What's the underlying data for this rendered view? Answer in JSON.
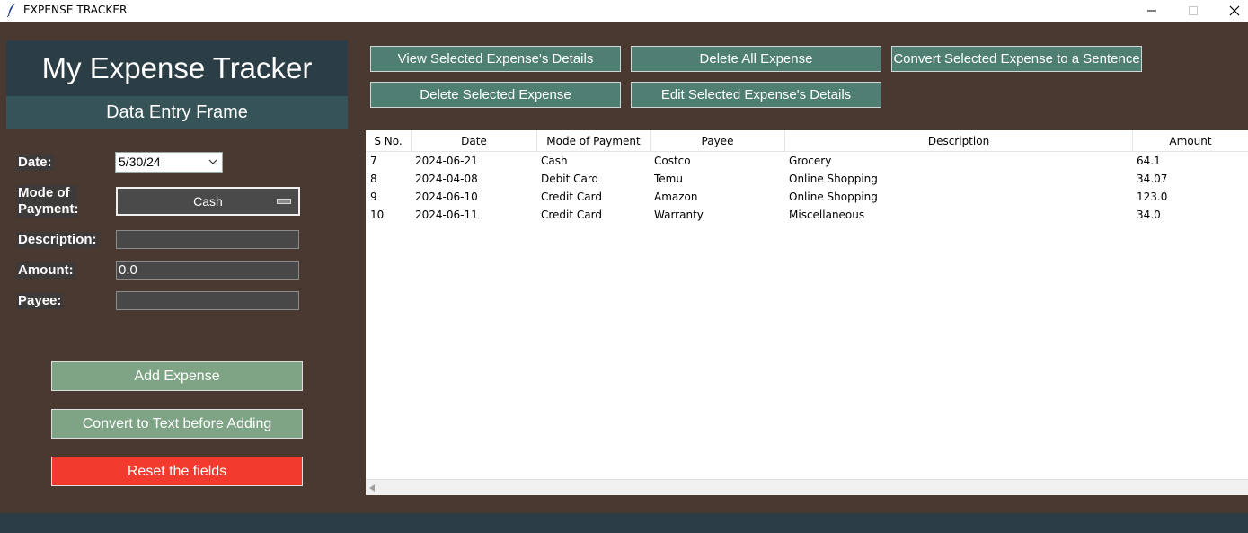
{
  "window": {
    "title": "EXPENSE TRACKER"
  },
  "left": {
    "heading": "My Expense Tracker",
    "subheading": "Data Entry Frame",
    "labels": {
      "date": "Date:",
      "mode": "Mode of Payment:",
      "description": "Description:",
      "amount": "Amount:",
      "payee": "Payee:"
    },
    "fields": {
      "date": "5/30/24",
      "mode": "Cash",
      "description": "",
      "amount": "0.0",
      "payee": ""
    },
    "buttons": {
      "add": "Add Expense",
      "convert": "Convert to Text before Adding",
      "reset": "Reset the fields"
    }
  },
  "toolbar": {
    "view": "View Selected Expense's Details",
    "delete_all": "Delete All Expense",
    "sentence": "Convert Selected Expense to a Sentence",
    "delete_selected": "Delete Selected Expense",
    "edit": "Edit Selected Expense's Details"
  },
  "table": {
    "columns": [
      "S No.",
      "Date",
      "Mode of Payment",
      "Payee",
      "Description",
      "Amount"
    ],
    "rows": [
      [
        "7",
        "2024-06-21",
        "Cash",
        "Costco",
        "Grocery",
        "64.1"
      ],
      [
        "8",
        "2024-04-08",
        "Debit Card",
        "Temu",
        "Online Shopping",
        "34.07"
      ],
      [
        "9",
        "2024-06-10",
        "Credit Card",
        "Amazon",
        "Online Shopping",
        "123.0"
      ],
      [
        "10",
        "2024-06-11",
        "Credit Card",
        "Warranty",
        "Miscellaneous",
        "34.0"
      ]
    ]
  },
  "colors": {
    "background": "#493930",
    "heading": "#2c3e45",
    "subheading": "#365358",
    "toolbar_button": "#4f7e72",
    "add_button": "#7ea385",
    "reset_button": "#f23b2e"
  }
}
